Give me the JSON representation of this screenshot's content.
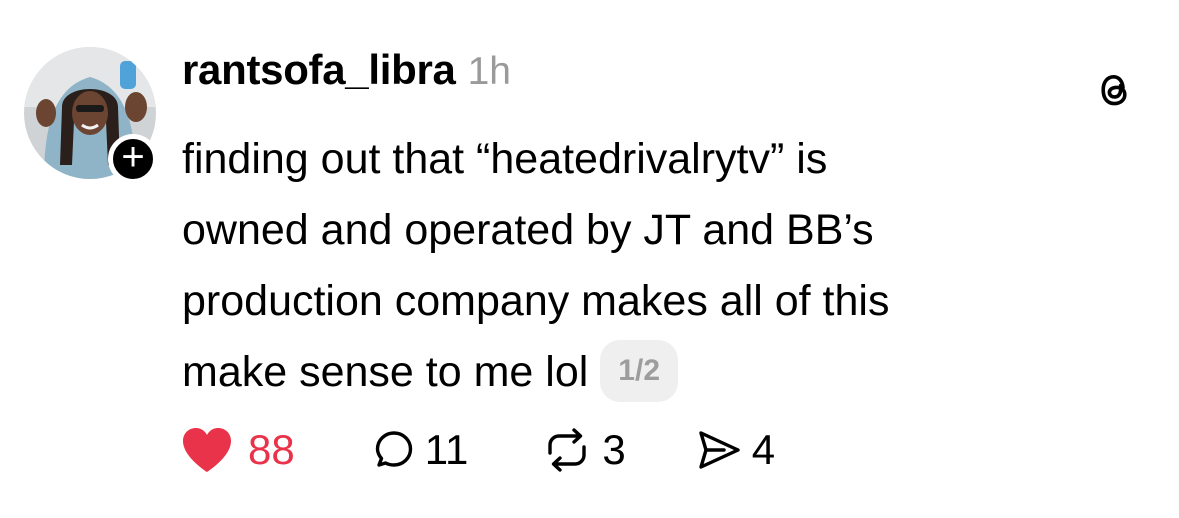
{
  "post": {
    "username": "rantsofa_libra",
    "timestamp": "1h",
    "follow_badge": "+",
    "text_lines": [
      "finding out that “heatedrivalrytv” is",
      "owned and operated by JT and BB’s",
      "production company makes all of this",
      "make sense to me lol"
    ],
    "thread_counter": "1/2",
    "actions": {
      "likes": "88",
      "replies": "11",
      "reposts": "3",
      "shares": "4"
    },
    "icons": {
      "like": "heart-filled-icon",
      "reply": "speech-bubble-icon",
      "repost": "repost-arrows-icon",
      "share": "paper-plane-icon",
      "app": "threads-logo-icon"
    },
    "colors": {
      "like": "#e8334a",
      "timestamp": "#9a9a9a",
      "counter_bg": "#efefef",
      "counter_text": "#9d9d9d"
    }
  }
}
